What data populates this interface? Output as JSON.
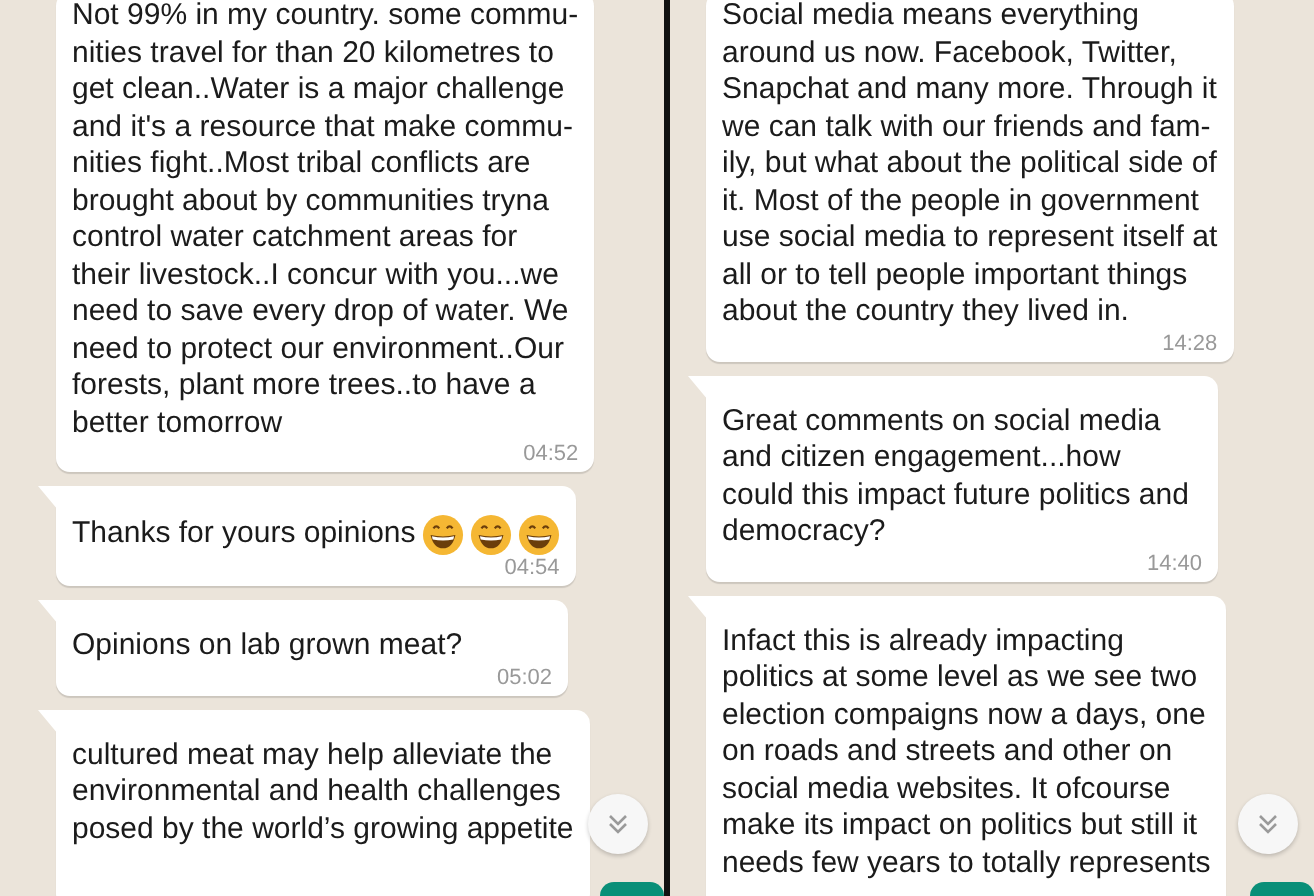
{
  "panels": [
    {
      "messages": [
        {
          "tail": false,
          "text": "Not 99% in my country. some commu-\nnities travel for than 20 kilometres to\nget clean..Water is a major challenge\nand it's a resource that make commu-\nnities fight..Most tribal conflicts are\nbrought about by communities tryna\ncontrol water catchment areas for\ntheir livestock..I concur with you...we\nneed to save every drop of water. We\nneed to protect our environment..Our\nforests, plant more trees..to have a\nbetter tomorrow",
          "time": "04:52"
        },
        {
          "tail": true,
          "text": "Thanks for yours opinions",
          "emojis": [
            {
              "kind": "grin"
            },
            {
              "kind": "grin"
            },
            {
              "kind": "grin"
            }
          ],
          "time": "04:54"
        },
        {
          "tail": true,
          "text": "Opinions on lab grown meat?",
          "time": "05:02"
        },
        {
          "tail": true,
          "text": "cultured meat may help alleviate the\nenvironmental and health challenges\nposed by the world’s growing appetite"
        }
      ]
    },
    {
      "messages": [
        {
          "tail": false,
          "text": "Social media means everything\naround us now. Facebook, Twitter,\nSnapchat and many more. Through it\nwe can talk with our friends and fam-\nily, but what about the political side of\nit. Most of the people in government\nuse social media to represent itself at\nall or to tell people important things\nabout the country they lived in.",
          "time": "14:28"
        },
        {
          "tail": true,
          "text": "Great comments on social media\nand citizen engagement...how\ncould this impact future politics and\ndemocracy?",
          "time": "14:40"
        },
        {
          "tail": true,
          "text": "Infact this is already impacting\npolitics at some level as we see two\nelection compaigns now a days, one\non roads and streets and other on\nsocial media websites. It ofcourse\nmake its impact on politics but still it\nneeds few years to totally represents"
        }
      ]
    }
  ]
}
